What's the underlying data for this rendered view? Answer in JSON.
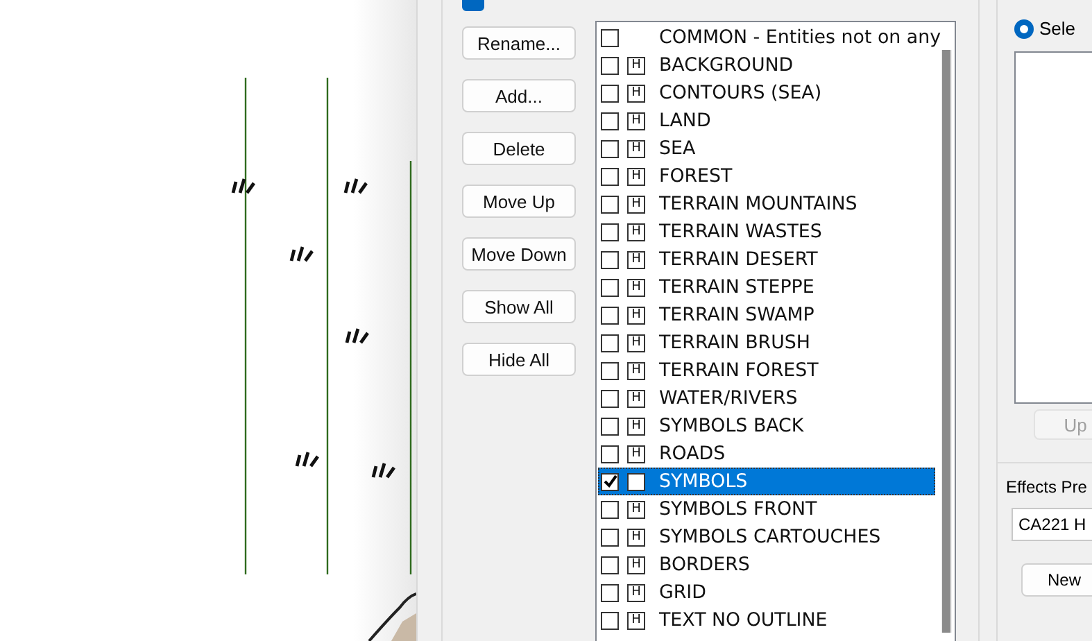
{
  "hide_all_option": {
    "checked": true
  },
  "buttons": [
    {
      "label": "Rename..."
    },
    {
      "label": "Add..."
    },
    {
      "label": "Delete"
    },
    {
      "label": "Move Up"
    },
    {
      "label": "Move Down"
    },
    {
      "label": "Show All"
    },
    {
      "label": "Hide All"
    }
  ],
  "sheets": [
    {
      "kind": "plain",
      "name": "COMMON - Entities not on any",
      "checked": false,
      "selected": false
    },
    {
      "kind": "sheet",
      "h": "H",
      "name": "BACKGROUND",
      "checked": false,
      "selected": false
    },
    {
      "kind": "sheet",
      "h": "H",
      "name": "CONTOURS (SEA)",
      "checked": false,
      "selected": false
    },
    {
      "kind": "sheet",
      "h": "H",
      "name": "LAND",
      "checked": false,
      "selected": false
    },
    {
      "kind": "sheet",
      "h": "H",
      "name": "SEA",
      "checked": false,
      "selected": false
    },
    {
      "kind": "sheet",
      "h": "H",
      "name": "FOREST",
      "checked": false,
      "selected": false
    },
    {
      "kind": "sheet",
      "h": "H",
      "name": "TERRAIN MOUNTAINS",
      "checked": false,
      "selected": false
    },
    {
      "kind": "sheet",
      "h": "H",
      "name": "TERRAIN WASTES",
      "checked": false,
      "selected": false
    },
    {
      "kind": "sheet",
      "h": "H",
      "name": "TERRAIN DESERT",
      "checked": false,
      "selected": false
    },
    {
      "kind": "sheet",
      "h": "H",
      "name": "TERRAIN STEPPE",
      "checked": false,
      "selected": false
    },
    {
      "kind": "sheet",
      "h": "H",
      "name": "TERRAIN SWAMP",
      "checked": false,
      "selected": false
    },
    {
      "kind": "sheet",
      "h": "H",
      "name": "TERRAIN BRUSH",
      "checked": false,
      "selected": false
    },
    {
      "kind": "sheet",
      "h": "H",
      "name": "TERRAIN FOREST",
      "checked": false,
      "selected": false
    },
    {
      "kind": "sheet",
      "h": "H",
      "name": "WATER/RIVERS",
      "checked": false,
      "selected": false
    },
    {
      "kind": "sheet",
      "h": "H",
      "name": "SYMBOLS BACK",
      "checked": false,
      "selected": false
    },
    {
      "kind": "sheet",
      "h": "H",
      "name": "ROADS",
      "checked": false,
      "selected": false
    },
    {
      "kind": "sheet",
      "name": "SYMBOLS",
      "checked": true,
      "selected": true
    },
    {
      "kind": "sheet",
      "h": "H",
      "name": "SYMBOLS FRONT",
      "checked": false,
      "selected": false
    },
    {
      "kind": "sheet",
      "h": "H",
      "name": "SYMBOLS CARTOUCHES",
      "checked": false,
      "selected": false
    },
    {
      "kind": "sheet",
      "h": "H",
      "name": "BORDERS",
      "checked": false,
      "selected": false
    },
    {
      "kind": "sheet",
      "h": "H",
      "name": "GRID",
      "checked": false,
      "selected": false
    },
    {
      "kind": "sheet",
      "h": "H",
      "name": "TEXT NO OUTLINE",
      "checked": false,
      "selected": false
    }
  ],
  "effects": {
    "radio_label": "Sele",
    "radio_selected": true,
    "up_button": {
      "label": "Up",
      "disabled": true
    },
    "presets_label": "Effects Pre",
    "preset_value": "CA221 H",
    "new_button": {
      "label": "New"
    }
  }
}
